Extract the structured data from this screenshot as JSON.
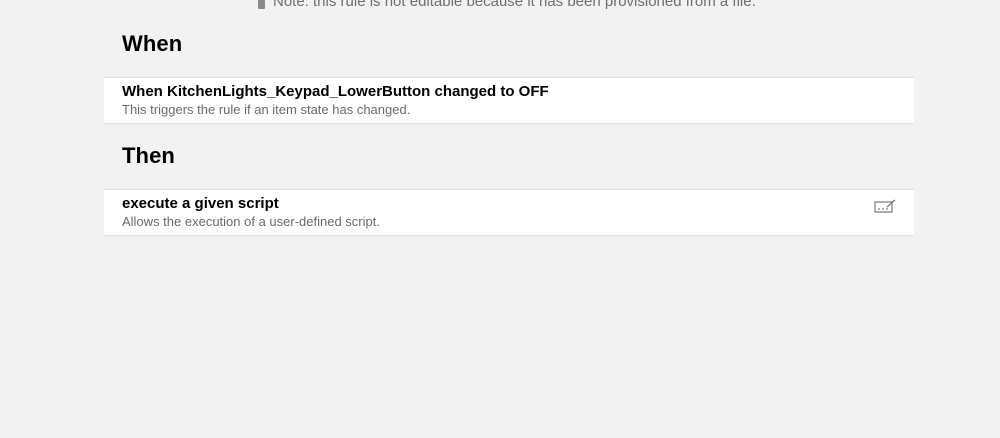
{
  "note": {
    "text": "Note: this rule is not editable because it has been provisioned from a file.",
    "icon": "lock-icon"
  },
  "when_section": {
    "title": "When",
    "items": [
      {
        "title": "When KitchenLights_Keypad_LowerButton changed to OFF",
        "description": "This triggers the rule if an item state has changed."
      }
    ]
  },
  "then_section": {
    "title": "Then",
    "items": [
      {
        "title": "execute a given script",
        "description": "Allows the execution of a user-defined script.",
        "action_icon": "edit-script-icon"
      }
    ]
  }
}
